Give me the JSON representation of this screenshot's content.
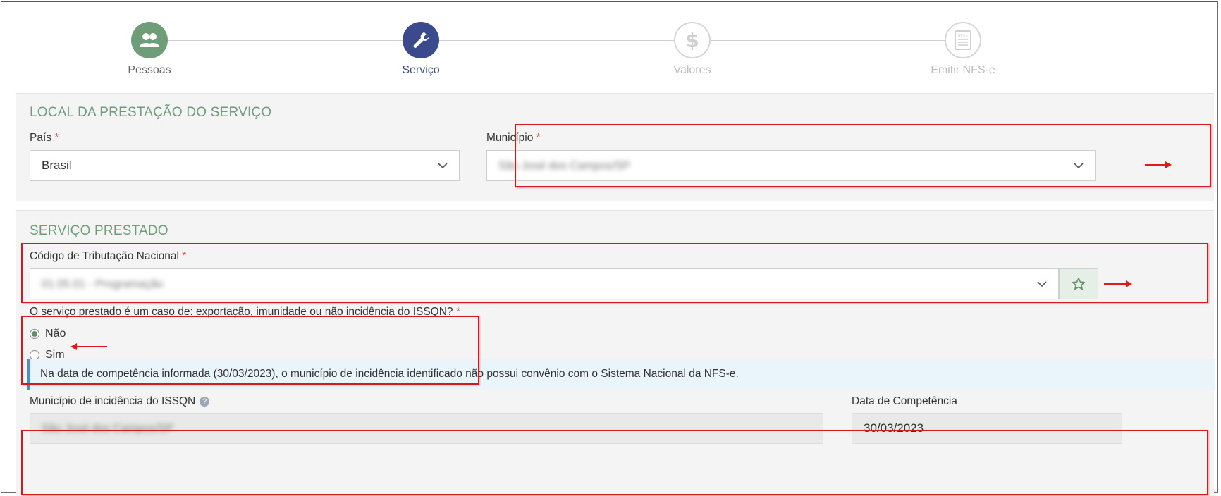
{
  "stepper": {
    "steps": [
      {
        "label": "Pessoas",
        "icon": "users-icon",
        "state": "done"
      },
      {
        "label": "Serviço",
        "icon": "wrench-icon",
        "state": "active"
      },
      {
        "label": "Valores",
        "icon": "dollar-icon",
        "state": "todo"
      },
      {
        "label": "Emitir NFS-e",
        "icon": "document-nfse-icon",
        "state": "todo",
        "icon_text": "NFS-e"
      }
    ]
  },
  "local": {
    "title": "LOCAL DA PRESTAÇÃO DO SERVIÇO",
    "pais_label": "País",
    "pais_value": "Brasil",
    "municipio_label": "Município",
    "municipio_value": "São José dos Campos/SP",
    "required_mark": "*"
  },
  "servico": {
    "title": "SERVIÇO PRESTADO",
    "codigo_label": "Código de Tributação Nacional",
    "codigo_value": "01.05.01 - Programação",
    "question": "O serviço prestado é um caso de: exportação, imunidade ou não incidência do ISSQN?",
    "options": [
      {
        "label": "Não",
        "checked": true
      },
      {
        "label": "Sim",
        "checked": false
      }
    ],
    "info": "Na data de competência informada (30/03/2023), o município de incidência identificado não possui convênio com o Sistema Nacional da NFS-e.",
    "incidencia_label": "Município de incidência do ISSQN",
    "incidencia_value": "São José dos Campos/SP",
    "help_icon": "?",
    "data_label": "Data de Competência",
    "data_value": "30/03/2023"
  },
  "colors": {
    "accent_green": "#6d9e77",
    "active_blue": "#3a4a8d",
    "annotation_red": "#d7191c",
    "info_blue": "#4c8fc7"
  }
}
